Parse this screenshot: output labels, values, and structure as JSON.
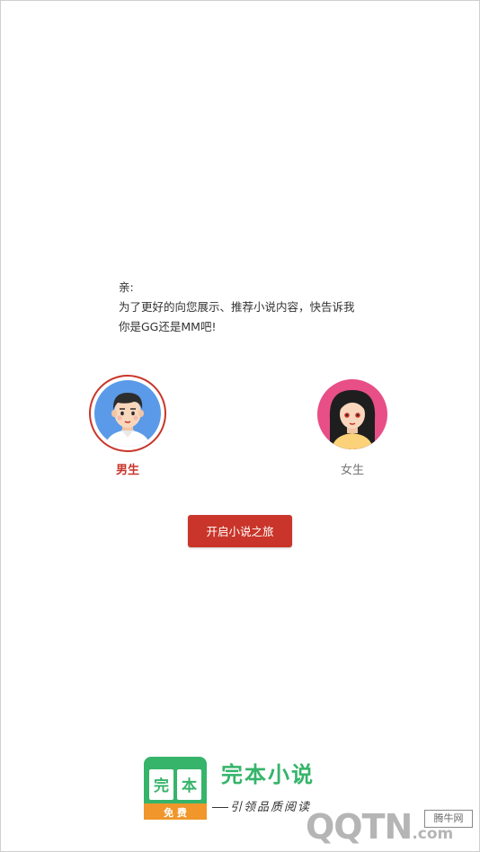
{
  "greeting": {
    "line1": "亲:",
    "line2": "为了更好的向您展示、推荐小说内容，快告诉我",
    "line3": "你是GG还是MM吧!"
  },
  "genders": {
    "male": {
      "label": "男生",
      "selected": true,
      "icon": "male-avatar-icon"
    },
    "female": {
      "label": "女生",
      "selected": false,
      "icon": "female-avatar-icon"
    }
  },
  "start_button": {
    "label": "开启小说之旅"
  },
  "brand": {
    "logo_char_left": "完",
    "logo_char_right": "本",
    "logo_badge": "免 费",
    "name": "完本小说",
    "slogan": "引领品质阅读"
  },
  "watermark": {
    "text": "QQTN",
    "suffix": ".com",
    "box": "腾牛网"
  },
  "colors": {
    "accent": "#c9352a",
    "brand_green": "#35b46a",
    "male_bg": "#5b9ae8",
    "female_bg": "#e84f86"
  }
}
